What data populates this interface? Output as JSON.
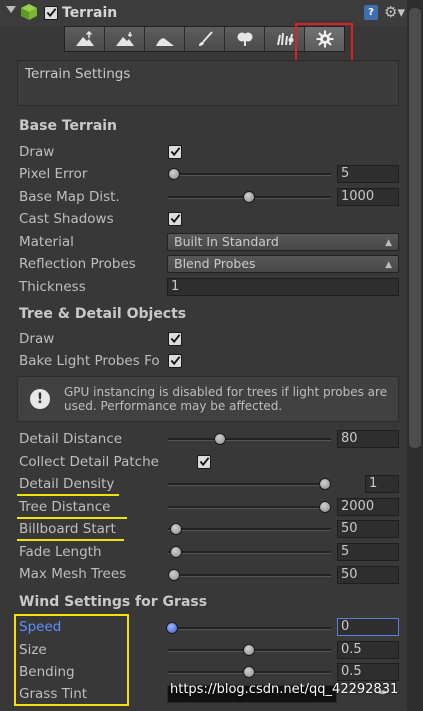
{
  "component": {
    "title": "Terrain",
    "help_symbol": "?",
    "settings_icon": "gear-icon",
    "enabled": true
  },
  "toolbar": {
    "tools": [
      {
        "icon": "raise-lower-terrain-icon"
      },
      {
        "icon": "paint-height-icon"
      },
      {
        "icon": "smooth-height-icon"
      },
      {
        "icon": "paint-texture-icon"
      },
      {
        "icon": "place-trees-icon"
      },
      {
        "icon": "paint-details-icon"
      },
      {
        "icon": "terrain-settings-gear-icon",
        "active": true
      }
    ]
  },
  "panel_title": "Terrain Settings",
  "base_terrain": {
    "heading": "Base Terrain",
    "draw": {
      "label": "Draw",
      "checked": true
    },
    "pixel_error": {
      "label": "Pixel Error",
      "value": "5",
      "fraction": 0.0
    },
    "base_map_dist": {
      "label": "Base Map Dist.",
      "value": "1000",
      "fraction": 0.5
    },
    "cast_shadows": {
      "label": "Cast Shadows",
      "checked": true
    },
    "material": {
      "label": "Material",
      "value": "Built In Standard"
    },
    "reflection_probes": {
      "label": "Reflection Probes",
      "value": "Blend Probes"
    },
    "thickness": {
      "label": "Thickness",
      "value": "1"
    }
  },
  "tree_detail": {
    "heading": "Tree & Detail Objects",
    "draw": {
      "label": "Draw",
      "checked": true
    },
    "bake_light_probes": {
      "label": "Bake Light Probes Fo",
      "checked": true
    },
    "info": {
      "icon": "info-icon",
      "symbol": "!",
      "text": "GPU instancing is disabled for trees if light probes are used. Performance may be affected."
    },
    "detail_distance": {
      "label": "Detail Distance",
      "value": "80",
      "fraction": 0.32
    },
    "collect_detail_patches": {
      "label": "Collect Detail Patche",
      "checked": true
    },
    "detail_density": {
      "label": "Detail Density",
      "value": "1",
      "fraction": 1.0
    },
    "tree_distance": {
      "label": "Tree Distance",
      "value": "2000",
      "fraction": 1.0
    },
    "billboard_start": {
      "label": "Billboard Start",
      "value": "50",
      "fraction": 0.02
    },
    "fade_length": {
      "label": "Fade Length",
      "value": "5",
      "fraction": 0.02
    },
    "max_mesh_trees": {
      "label": "Max Mesh Trees",
      "value": "50",
      "fraction": 0.0
    }
  },
  "wind": {
    "heading": "Wind Settings for Grass",
    "speed": {
      "label": "Speed",
      "value": "0",
      "fraction": 0.0
    },
    "size": {
      "label": "Size",
      "value": "0.5",
      "fraction": 0.5
    },
    "bending": {
      "label": "Bending",
      "value": "0.5",
      "fraction": 0.5
    },
    "grass_tint": {
      "label": "Grass Tint"
    }
  },
  "watermark": "https://blog.csdn.net/qq_42292831",
  "colors": {
    "highlight_red": "#e02020",
    "highlight_yellow": "#f2e20c",
    "focus_blue": "#5b7fd1"
  }
}
